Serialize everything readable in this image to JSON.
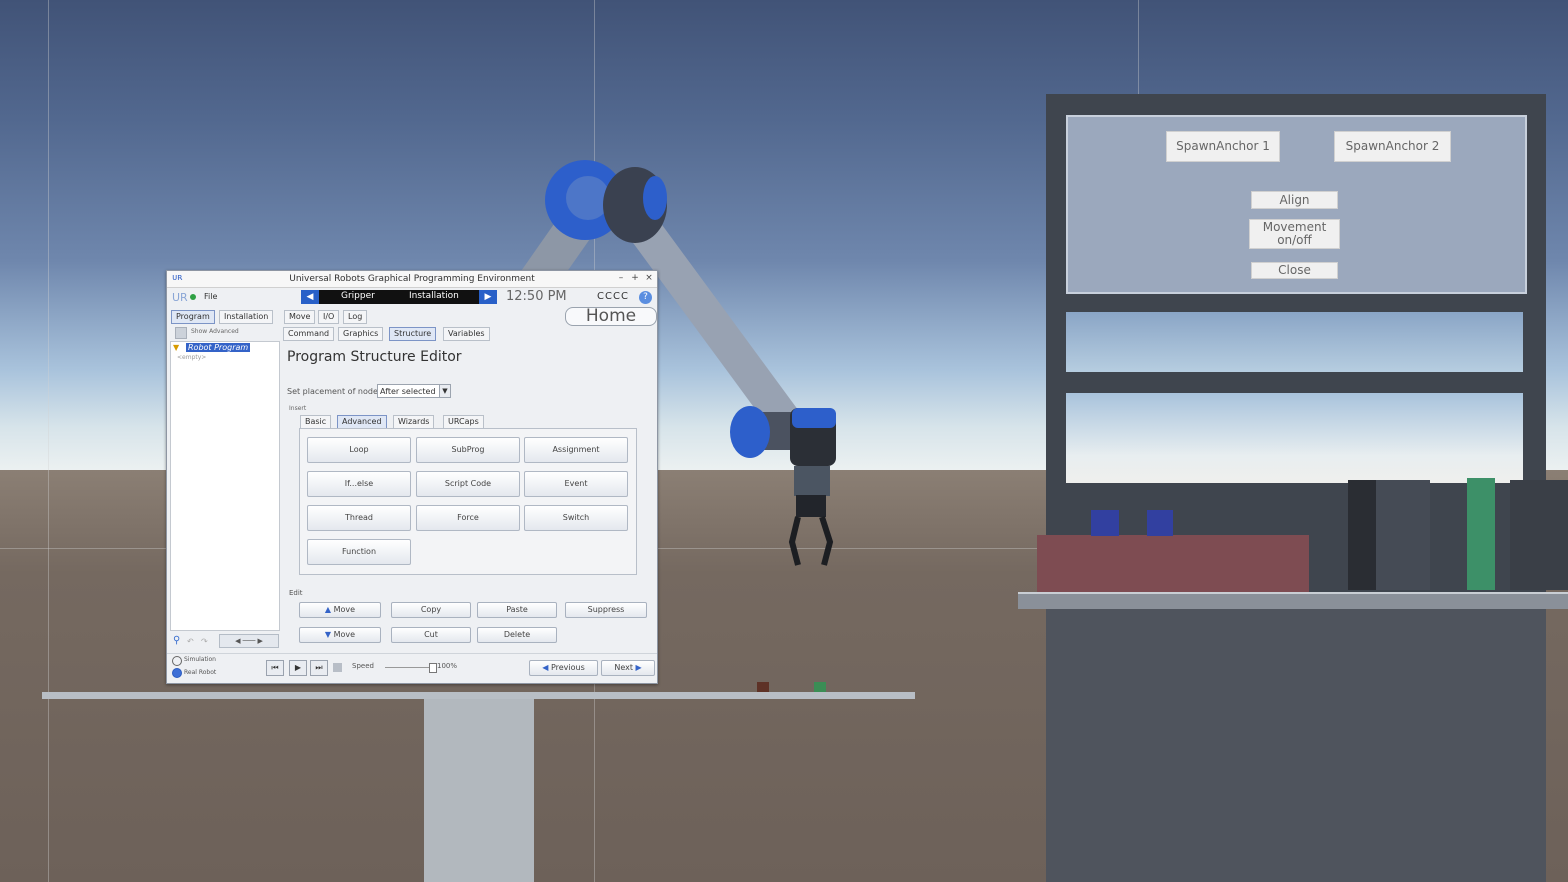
{
  "scene": {
    "spawn_panel": {
      "spawn_anchor_1": "SpawnAnchor 1",
      "spawn_anchor_2": "SpawnAnchor 2",
      "align": "Align",
      "movement_line1": "Movement",
      "movement_line2": "on/off",
      "close": "Close"
    }
  },
  "urg": {
    "title": "Universal Robots Graphical Programming Environment",
    "window_controls": {
      "minimize": "–",
      "maximize": "+",
      "close": "×"
    },
    "logo": "UR",
    "file_label": "File",
    "nav_left": "Gripper",
    "nav_right": "Installation",
    "clock": "12:50 PM",
    "status_code": "CCCC",
    "help": "?",
    "home": "Home",
    "main_tabs": [
      "Program",
      "Installation",
      "Move",
      "I/O",
      "Log"
    ],
    "sub_tabs": [
      "Command",
      "Graphics",
      "Structure",
      "Variables"
    ],
    "tree": {
      "toolbar_label": "Show Advanced",
      "root": "Robot Program",
      "child": "<empty>"
    },
    "editor_title": "Program Structure Editor",
    "placement_label": "Set placement of node:",
    "placement_value": "After selected",
    "insert_label": "Insert",
    "command_tabs": [
      "Basic",
      "Advanced",
      "Wizards",
      "URCaps"
    ],
    "commands": [
      "Loop",
      "SubProg",
      "Assignment",
      "If...else",
      "Script Code",
      "Event",
      "Thread",
      "Force",
      "Switch",
      "Function"
    ],
    "edit_label": "Edit",
    "edit_buttons": [
      "Move",
      "Copy",
      "Paste",
      "Suppress",
      "Move",
      "Cut",
      "Delete"
    ],
    "tree_nav": "◀ ─── ▶",
    "simulation_label": "Simulation",
    "real_robot_label": "Real Robot",
    "speed_label": "Speed",
    "speed_value": "100%",
    "previous": "Previous",
    "next": "Next"
  }
}
